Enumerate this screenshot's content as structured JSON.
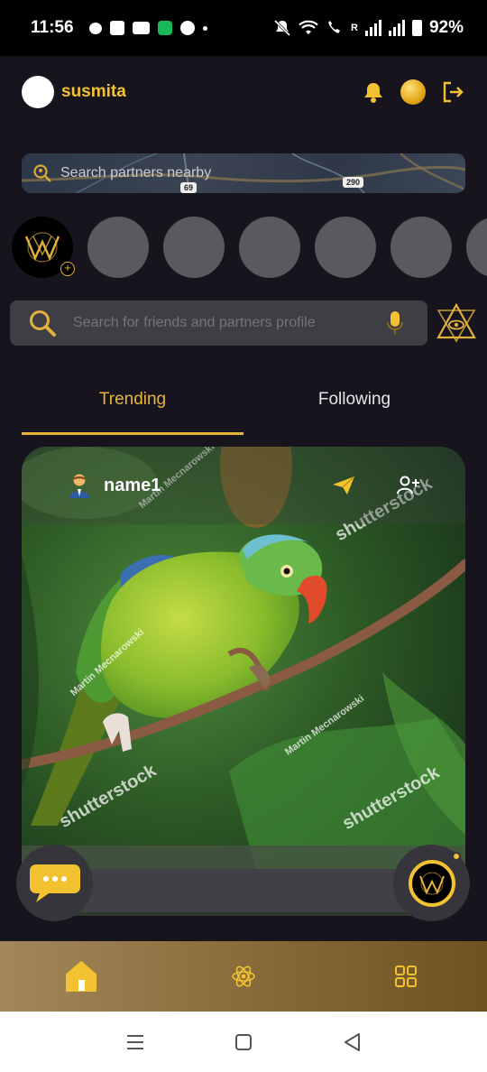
{
  "status_bar": {
    "time": "11:56",
    "carrier_tag": "R",
    "battery": "92%",
    "icons": [
      "chat-bubble-icon",
      "linkedin-icon",
      "youtube-icon",
      "app-icon",
      "facebook-icon",
      "mute-icon",
      "wifi-icon",
      "signal-icon",
      "battery-icon"
    ]
  },
  "header": {
    "username": "susmita",
    "icons": [
      "bell-icon",
      "coin-icon",
      "logout-icon"
    ]
  },
  "map_search": {
    "placeholder": "Search partners nearby",
    "route_labels": [
      "69",
      "290"
    ]
  },
  "stories": {
    "placeholder_count": 6
  },
  "profile_search": {
    "placeholder": "Search for friends and partners profile"
  },
  "tabs": [
    {
      "label": "Trending",
      "active": true
    },
    {
      "label": "Following",
      "active": false
    }
  ],
  "post": {
    "author": "name1",
    "watermarks": [
      "shutterstock",
      "shutterstock",
      "shutterstock",
      "Martin Mecnarowski",
      "Martin Mecnarowski",
      "Martin Mecnarowski"
    ]
  },
  "bottom_nav": {
    "items": [
      "home-icon",
      "atom-icon",
      "grid-icon"
    ]
  },
  "system_nav": {
    "items": [
      "recents-icon",
      "home-square-icon",
      "back-icon"
    ]
  },
  "colors": {
    "accent": "#e8b53a",
    "background": "#17141d",
    "search_bg": "#3f3e45",
    "story_placeholder": "#5a595e"
  }
}
